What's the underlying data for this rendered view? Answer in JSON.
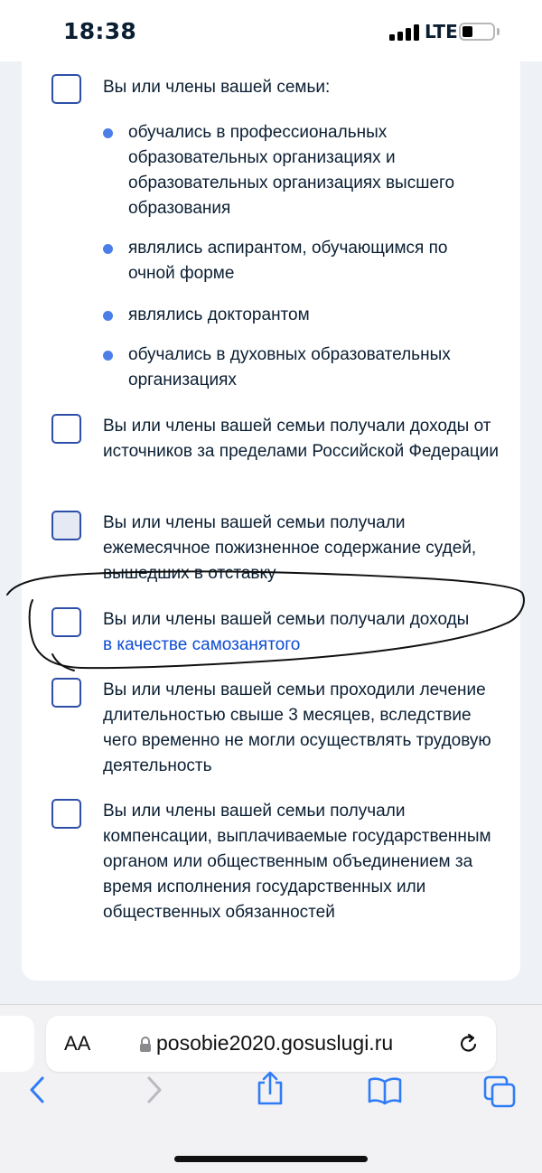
{
  "status_bar": {
    "time": "18:38",
    "network": "LTE",
    "battery_level": 0.25
  },
  "form": {
    "items": [
      {
        "label": "Вы или члены вашей семьи:",
        "checked": false,
        "bullets": [
          "обучались в профессиональных образовательных организациях и образовательных организациях высшего образования",
          "являлись аспирантом, обучающимся по очной форме",
          "являлись докторантом",
          "обучались в духовных образовательных организациях"
        ]
      },
      {
        "label": "Вы или члены вашей семьи получали доходы от источников за пределами Российской Федерации",
        "checked": false
      },
      {
        "label": "Вы или члены вашей семьи получали ежемесячное пожизненное содержание судей, вышедших в отставку",
        "checked": false,
        "disabled": true
      },
      {
        "label": "Вы или члены вашей семьи получали доходы",
        "link": "в качестве самозанятого",
        "checked": false,
        "annotated": true
      },
      {
        "label": "Вы или члены вашей семьи проходили лечение длительностью свыше 3 месяцев, вследствие чего временно не могли осуществлять трудовую деятельность",
        "checked": false
      },
      {
        "label": "Вы или члены вашей семьи получали компенсации, выплачиваемые государственным органом или общественным объединением за время исполнения государственных или общественных обязанностей",
        "checked": false
      }
    ]
  },
  "browser": {
    "text_size_label": "AA",
    "url": "posobie2020.gosuslugi.ru"
  },
  "icons": {
    "signal": "cellular-signal-icon",
    "battery": "battery-icon",
    "lock": "lock-icon",
    "reload": "reload-icon",
    "back": "chevron-left-icon",
    "forward": "chevron-right-icon",
    "share": "share-icon",
    "bookmarks": "book-icon",
    "tabs": "tabs-icon"
  },
  "colors": {
    "checkbox_border": "#2d4fa8",
    "bullet": "#4b7ee8",
    "link": "#0d4cd3",
    "text": "#0b1f33"
  }
}
